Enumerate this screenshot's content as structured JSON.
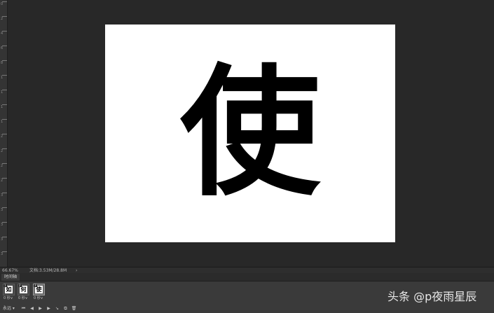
{
  "canvas": {
    "character": "使"
  },
  "ruler": {
    "marks": [
      "0",
      "2",
      "4",
      "6",
      "8",
      "1",
      "1",
      "1",
      "1",
      "2",
      "2",
      "2",
      "2",
      "3",
      "3",
      "3",
      "3",
      "3"
    ]
  },
  "status": {
    "zoom": "66.67%",
    "doc_size": "文档:3.53M/28.8M",
    "arrow": "›"
  },
  "timeline": {
    "tab_label": "时间轴",
    "frames": [
      {
        "number": "1",
        "glyph": "如",
        "delay": "0 秒∨"
      },
      {
        "number": "2",
        "glyph": "何",
        "delay": "0 秒∨"
      },
      {
        "number": "3",
        "glyph": "使",
        "delay": "0 秒∨"
      }
    ],
    "loop_label": "永远 ▾",
    "controls": {
      "first": "⏮",
      "prev": "◀",
      "play": "▶",
      "next": "▶",
      "tween": "↘",
      "duplicate": "⧉",
      "delete": "🗑"
    }
  },
  "watermark": {
    "text": "头条 @p夜雨星辰"
  }
}
